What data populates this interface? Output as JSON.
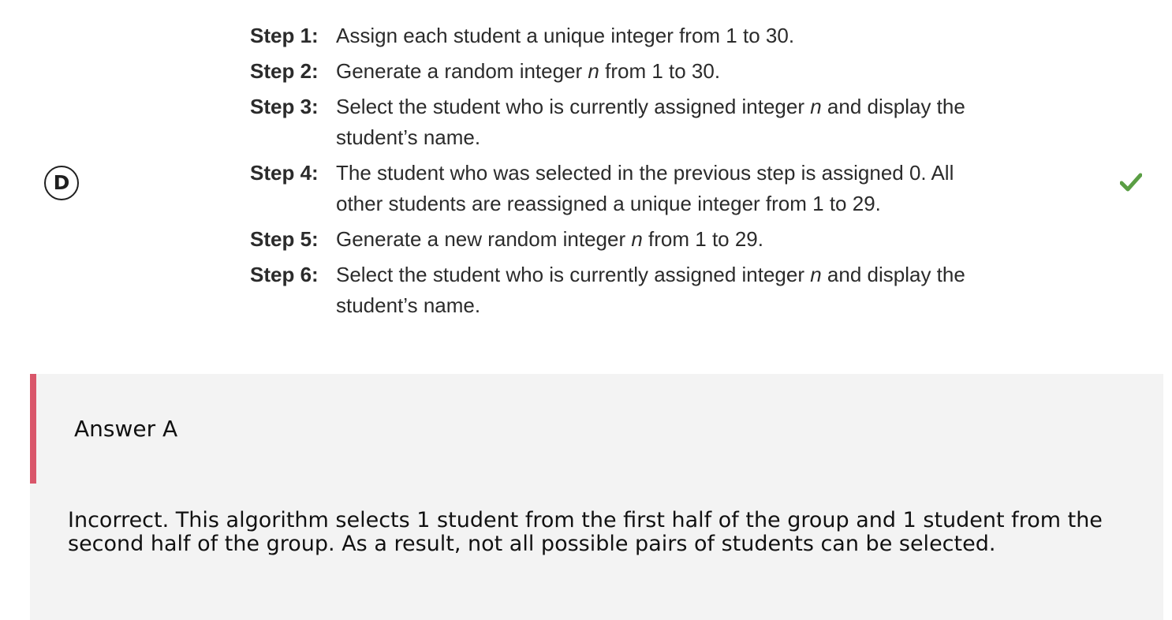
{
  "option": {
    "letter": "D",
    "status_icon": "check-icon",
    "status_color": "#5a9e44"
  },
  "steps": [
    {
      "label": "Step 1:",
      "parts": [
        "Assign each student a unique integer from 1 to 30."
      ]
    },
    {
      "label": "Step 2:",
      "parts": [
        "Generate a random integer ",
        "n",
        " from 1 to 30."
      ]
    },
    {
      "label": "Step 3:",
      "parts": [
        "Select the student who is currently assigned integer ",
        "n",
        " and display the student’s name."
      ]
    },
    {
      "label": "Step 4:",
      "parts": [
        "The student who was selected in the previous step is assigned 0. All other students are reassigned a unique integer from 1 to 29."
      ]
    },
    {
      "label": "Step 5:",
      "parts": [
        "Generate a new random integer ",
        "n",
        " from 1 to 29."
      ]
    },
    {
      "label": "Step 6:",
      "parts": [
        "Select the student who is currently assigned integer ",
        "n",
        " and display the student’s name."
      ]
    }
  ],
  "feedback": {
    "title": "Answer A",
    "body": "Incorrect. This algorithm selects 1 student from the first half of the group and 1 student from the second half of the group. As a result, not all possible pairs of students can be selected.",
    "accent_color": "#d9566a"
  }
}
